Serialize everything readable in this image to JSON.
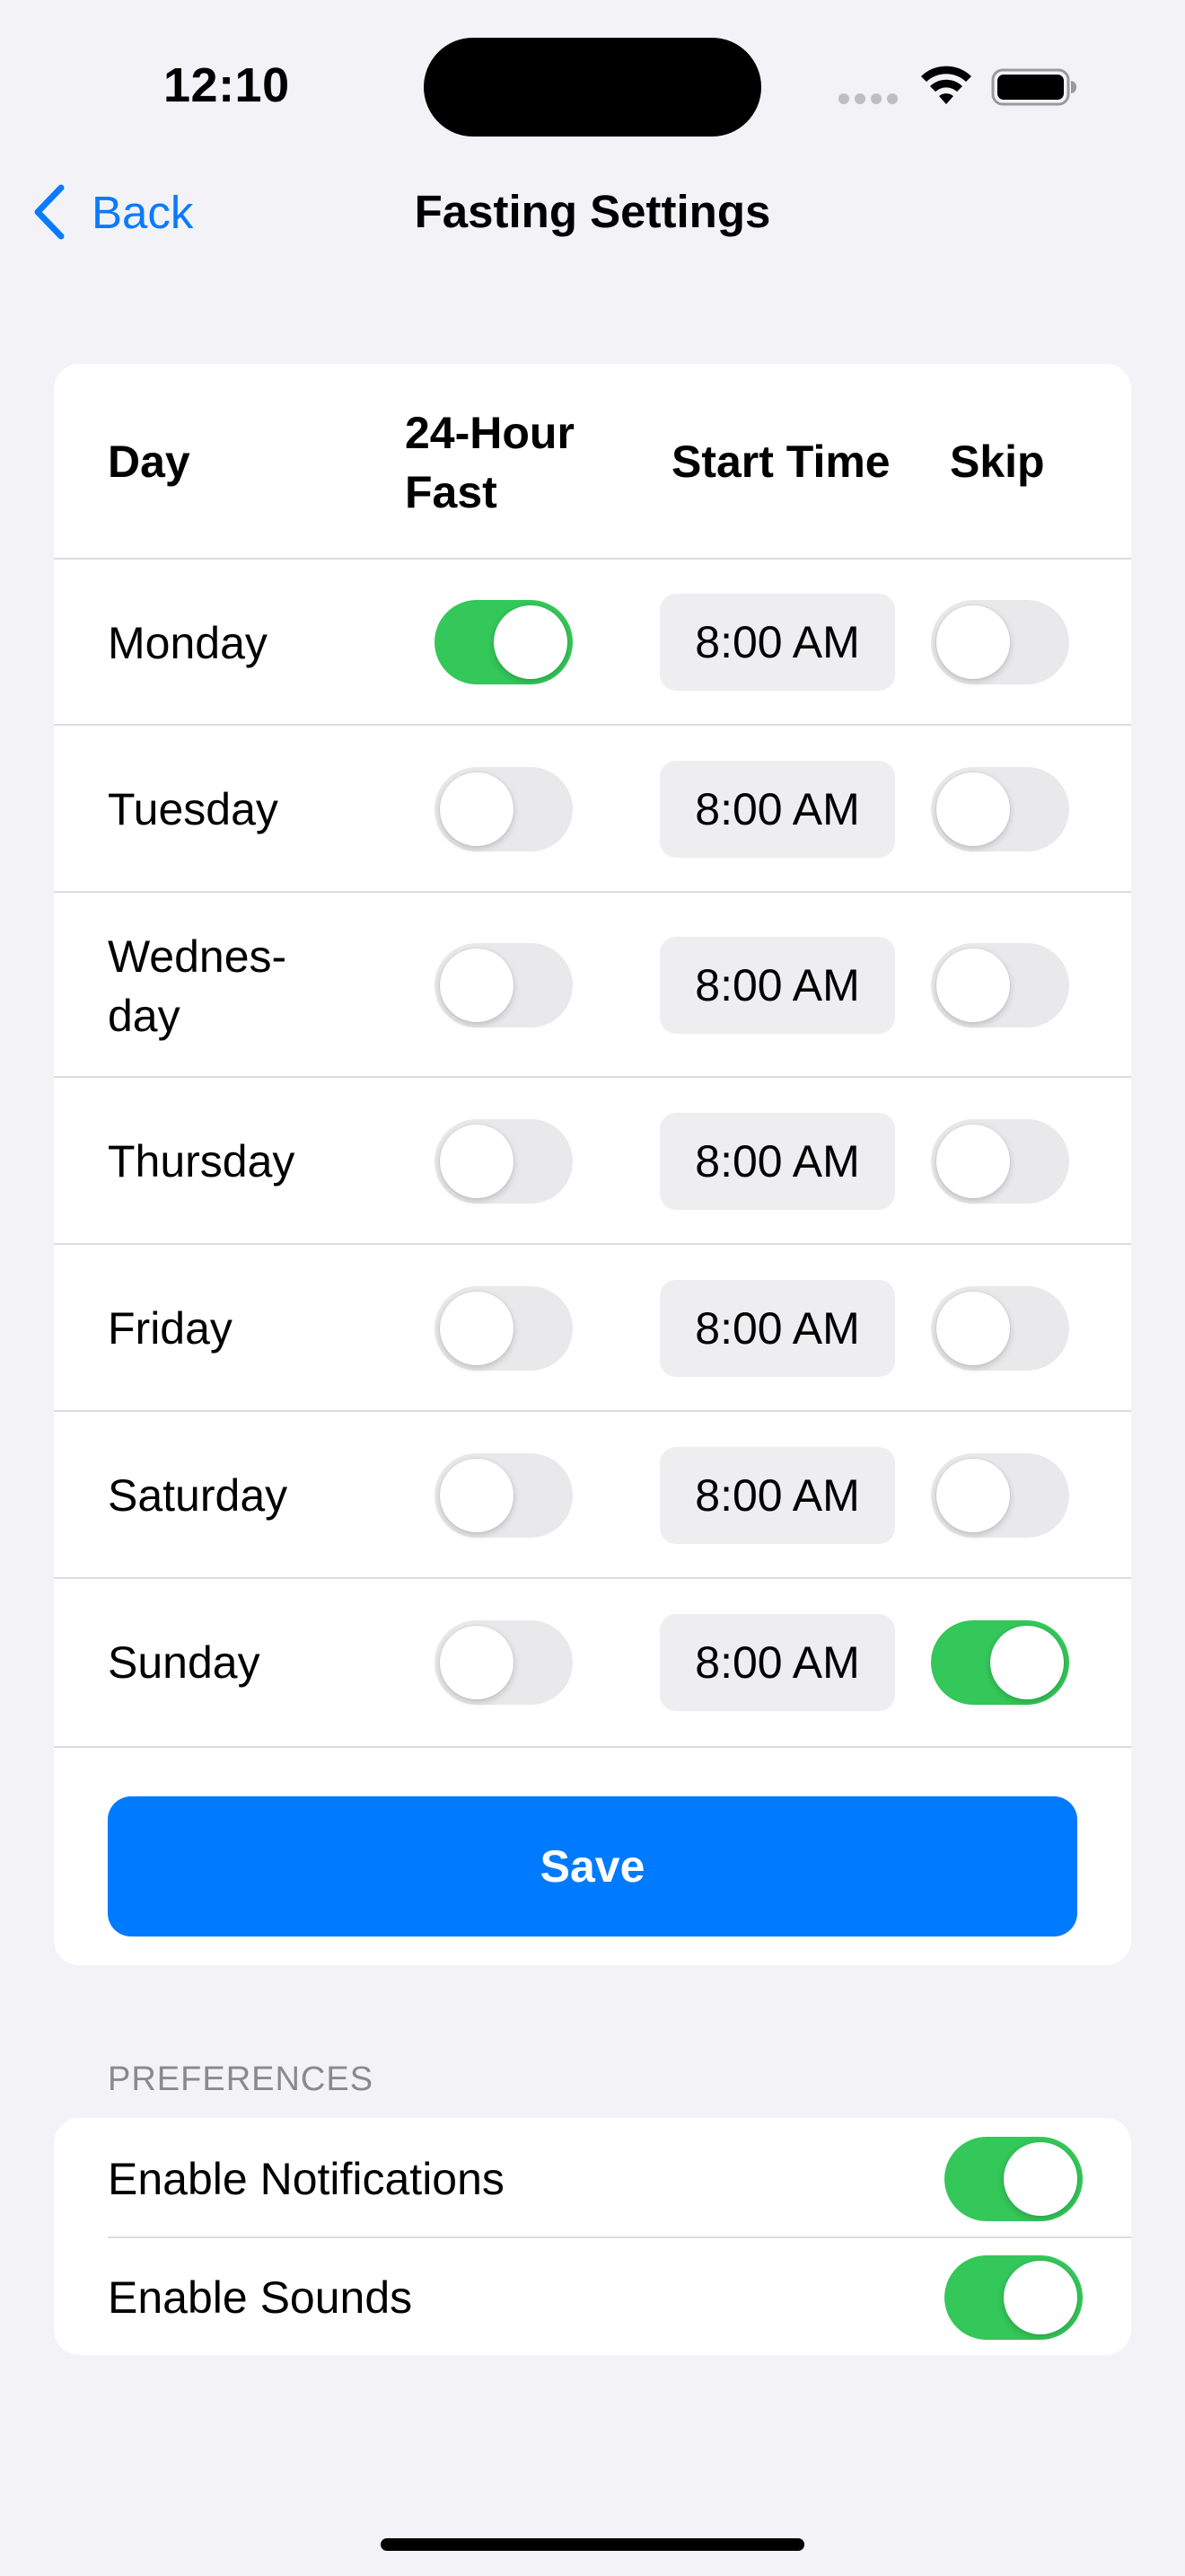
{
  "status_bar": {
    "time": "12:10"
  },
  "nav": {
    "back_label": "Back",
    "title": "Fasting Settings"
  },
  "table": {
    "headers": {
      "day": "Day",
      "fast_line1": "24-Hour",
      "fast_line2": "Fast",
      "start": "Start Time",
      "skip": "Skip"
    },
    "rows": [
      {
        "day": "Monday",
        "fast": true,
        "start_time": "8:00 AM",
        "skip": false
      },
      {
        "day": "Tuesday",
        "fast": false,
        "start_time": "8:00 AM",
        "skip": false
      },
      {
        "day_line1": "Wednes-",
        "day_line2": "day",
        "fast": false,
        "start_time": "8:00 AM",
        "skip": false
      },
      {
        "day": "Thursday",
        "fast": false,
        "start_time": "8:00 AM",
        "skip": false
      },
      {
        "day": "Friday",
        "fast": false,
        "start_time": "8:00 AM",
        "skip": false
      },
      {
        "day": "Saturday",
        "fast": false,
        "start_time": "8:00 AM",
        "skip": false
      },
      {
        "day": "Sunday",
        "fast": false,
        "start_time": "8:00 AM",
        "skip": true
      }
    ],
    "save_label": "Save"
  },
  "preferences": {
    "section_label": "PREFERENCES",
    "items": [
      {
        "label": "Enable Notifications",
        "enabled": true
      },
      {
        "label": "Enable Sounds",
        "enabled": true
      }
    ]
  },
  "colors": {
    "accent": "#007AFF",
    "toggle_on": "#34C759",
    "toggle_off": "#E9E9EB",
    "background": "#F2F2F7"
  }
}
